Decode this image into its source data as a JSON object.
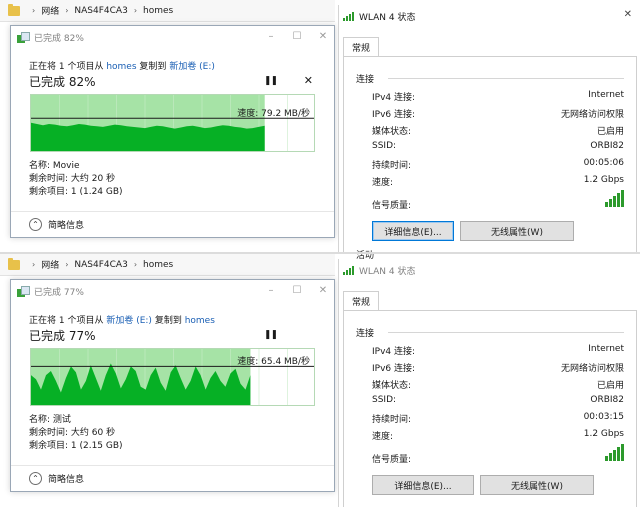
{
  "panels": [
    {
      "explorer": {
        "breadcrumbs": [
          "网络",
          "NAS4F4CA3",
          "homes"
        ]
      },
      "copy_dialog": {
        "title": "已完成 82%",
        "copy_prefix": "正在将 1 个项目从",
        "source": "homes",
        "copy_middle": "复制到",
        "destination": "新加卷 (E:)",
        "percent_label": "已完成 82%",
        "progress_percent": 82,
        "speed": "速度: 79.2 MB/秒",
        "speed_level": 0.6,
        "throughput": [
          0.52,
          0.5,
          0.48,
          0.5,
          0.49,
          0.47,
          0.46,
          0.48,
          0.5,
          0.49,
          0.47,
          0.46,
          0.45,
          0.47,
          0.49,
          0.48,
          0.46,
          0.45,
          0.44,
          0.43,
          0.45,
          0.47,
          0.46,
          0.44,
          0.42,
          0.44,
          0.46,
          0.47,
          0.45,
          0.43,
          0.44,
          0.46,
          0.48,
          0.47,
          0.45,
          0.44,
          0.42,
          0.43,
          0.45,
          0.47
        ],
        "name_label": "名称: Movie",
        "time_label": "剩余时间: 大约 20 秒",
        "items_label": "剩余项目: 1 (1.24 GB)",
        "details_label": "简略信息"
      },
      "wlan": {
        "title": "WLAN 4 状态",
        "tab": "常规",
        "connection_group": "连接",
        "rows": [
          {
            "label": "IPv4 连接:",
            "value": "Internet"
          },
          {
            "label": "IPv6 连接:",
            "value": "无网络访问权限"
          },
          {
            "label": "媒体状态:",
            "value": "已启用"
          },
          {
            "label": "SSID:",
            "value": "ORBI82"
          },
          {
            "label": "持续时间:",
            "value": "00:05:06"
          },
          {
            "label": "速度:",
            "value": "1.2 Gbps"
          }
        ],
        "signal_label": "信号质量:",
        "signal_bars": 5,
        "details_button": "详细信息(E)...",
        "wireless_button": "无线属性(W)",
        "activity_group": "活动"
      }
    },
    {
      "explorer": {
        "breadcrumbs": [
          "网络",
          "NAS4F4CA3",
          "homes"
        ]
      },
      "copy_dialog": {
        "title": "已完成 77%",
        "copy_prefix": "正在将 1 个项目从",
        "source": "新加卷 (E:)",
        "copy_middle": "复制到",
        "destination": "homes",
        "percent_label": "已完成 77%",
        "progress_percent": 77,
        "speed": "速度: 65.4 MB/秒",
        "speed_level": 0.7,
        "throughput": [
          0.55,
          0.48,
          0.3,
          0.55,
          0.62,
          0.45,
          0.25,
          0.5,
          0.7,
          0.6,
          0.3,
          0.45,
          0.72,
          0.5,
          0.28,
          0.55,
          0.75,
          0.58,
          0.32,
          0.48,
          0.7,
          0.62,
          0.35,
          0.3,
          0.55,
          0.68,
          0.42,
          0.28,
          0.6,
          0.72,
          0.5,
          0.3,
          0.45,
          0.7,
          0.55,
          0.3,
          0.5,
          0.62,
          0.45,
          0.35,
          0.58,
          0.66,
          0.4,
          0.3,
          0.55
        ],
        "name_label": "名称: 测试",
        "time_label": "剩余时间: 大约 60 秒",
        "items_label": "剩余项目: 1 (2.15 GB)",
        "details_label": "简略信息"
      },
      "wlan": {
        "title": "WLAN 4 状态",
        "tab": "常规",
        "connection_group": "连接",
        "rows": [
          {
            "label": "IPv4 连接:",
            "value": "Internet"
          },
          {
            "label": "IPv6 连接:",
            "value": "无网络访问权限"
          },
          {
            "label": "媒体状态:",
            "value": "已启用"
          },
          {
            "label": "SSID:",
            "value": "ORBI82"
          },
          {
            "label": "持续时间:",
            "value": "00:03:15"
          },
          {
            "label": "速度:",
            "value": "1.2 Gbps"
          }
        ],
        "signal_label": "信号质量:",
        "signal_bars": 5,
        "details_button": "详细信息(E)...",
        "wireless_button": "无线属性(W)"
      }
    }
  ],
  "colors": {
    "progress_fill": "#06b025",
    "progress_light": "#a6e3a6",
    "link": "#1a5fb4",
    "signal": "#2c9a2c"
  }
}
